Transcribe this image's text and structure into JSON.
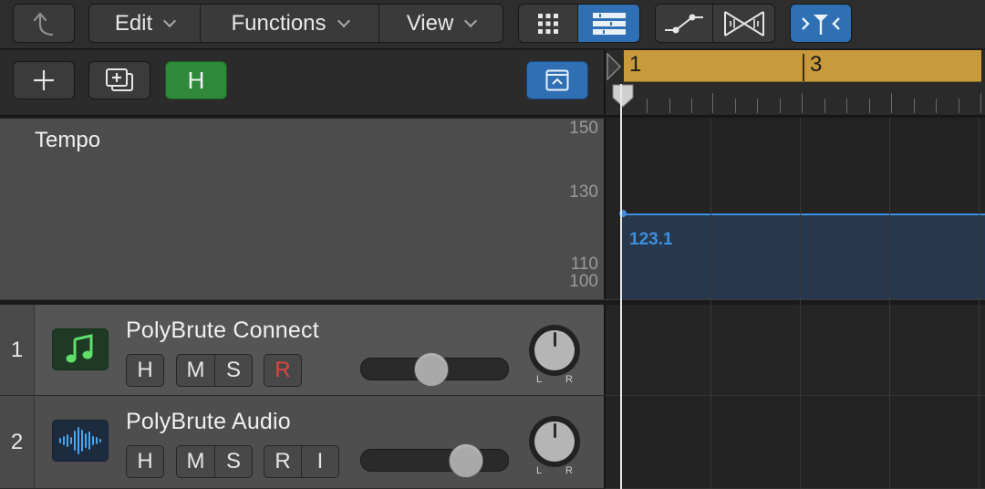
{
  "toolbar": {
    "menus": [
      {
        "label": "Edit"
      },
      {
        "label": "Functions"
      },
      {
        "label": "View"
      }
    ]
  },
  "colors": {
    "accent_blue": "#2f6fb3",
    "cycle_region": "#c79a3b",
    "hide_green": "#2e8a3a",
    "record_red": "#e0453b",
    "tempo_line": "#3d8fe0"
  },
  "controls": {
    "hide_label": "H"
  },
  "ruler": {
    "bars": [
      {
        "label": "1"
      },
      {
        "label": "3"
      }
    ]
  },
  "tempo_track": {
    "name": "Tempo",
    "scale": [
      {
        "label": "150"
      },
      {
        "label": "130"
      },
      {
        "label": "110"
      },
      {
        "label": "100"
      }
    ],
    "value": "123.1"
  },
  "tracks": [
    {
      "number": "1",
      "name": "PolyBrute Connect",
      "icon": "music-note-icon",
      "buttons": {
        "h": "H",
        "m": "M",
        "s": "S",
        "r": "R"
      },
      "pan_left": "L",
      "pan_right": "R"
    },
    {
      "number": "2",
      "name": "PolyBrute Audio",
      "icon": "waveform-icon",
      "buttons": {
        "h": "H",
        "m": "M",
        "s": "S",
        "r": "R",
        "i": "I"
      },
      "pan_left": "L",
      "pan_right": "R"
    }
  ]
}
